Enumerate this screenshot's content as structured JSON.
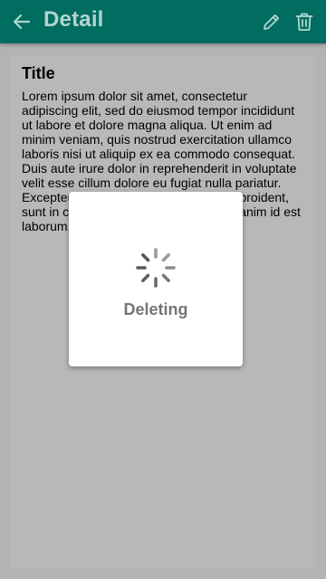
{
  "appbar": {
    "title": "Detail",
    "back_icon": "arrow-left-icon",
    "edit_icon": "pencil-icon",
    "delete_icon": "trash-icon",
    "color": "#006d60"
  },
  "card": {
    "title": "Title",
    "body": "Lorem ipsum dolor sit amet, consectetur adipiscing elit, sed do eiusmod tempor incididunt ut labore et dolore magna aliqua. Ut enim ad minim veniam, quis nostrud exercitation ullamco laboris nisi ut aliquip ex ea commodo consequat. Duis aute irure dolor in reprehenderit in voluptate velit esse cillum dolore eu fugiat nulla pariatur. Excepteur sint occaecat cupidatat non proident, sunt in culpa qui officia deserunt mollit anim id est laborum."
  },
  "dialog": {
    "label": "Deleting",
    "icon": "spinner-icon"
  }
}
